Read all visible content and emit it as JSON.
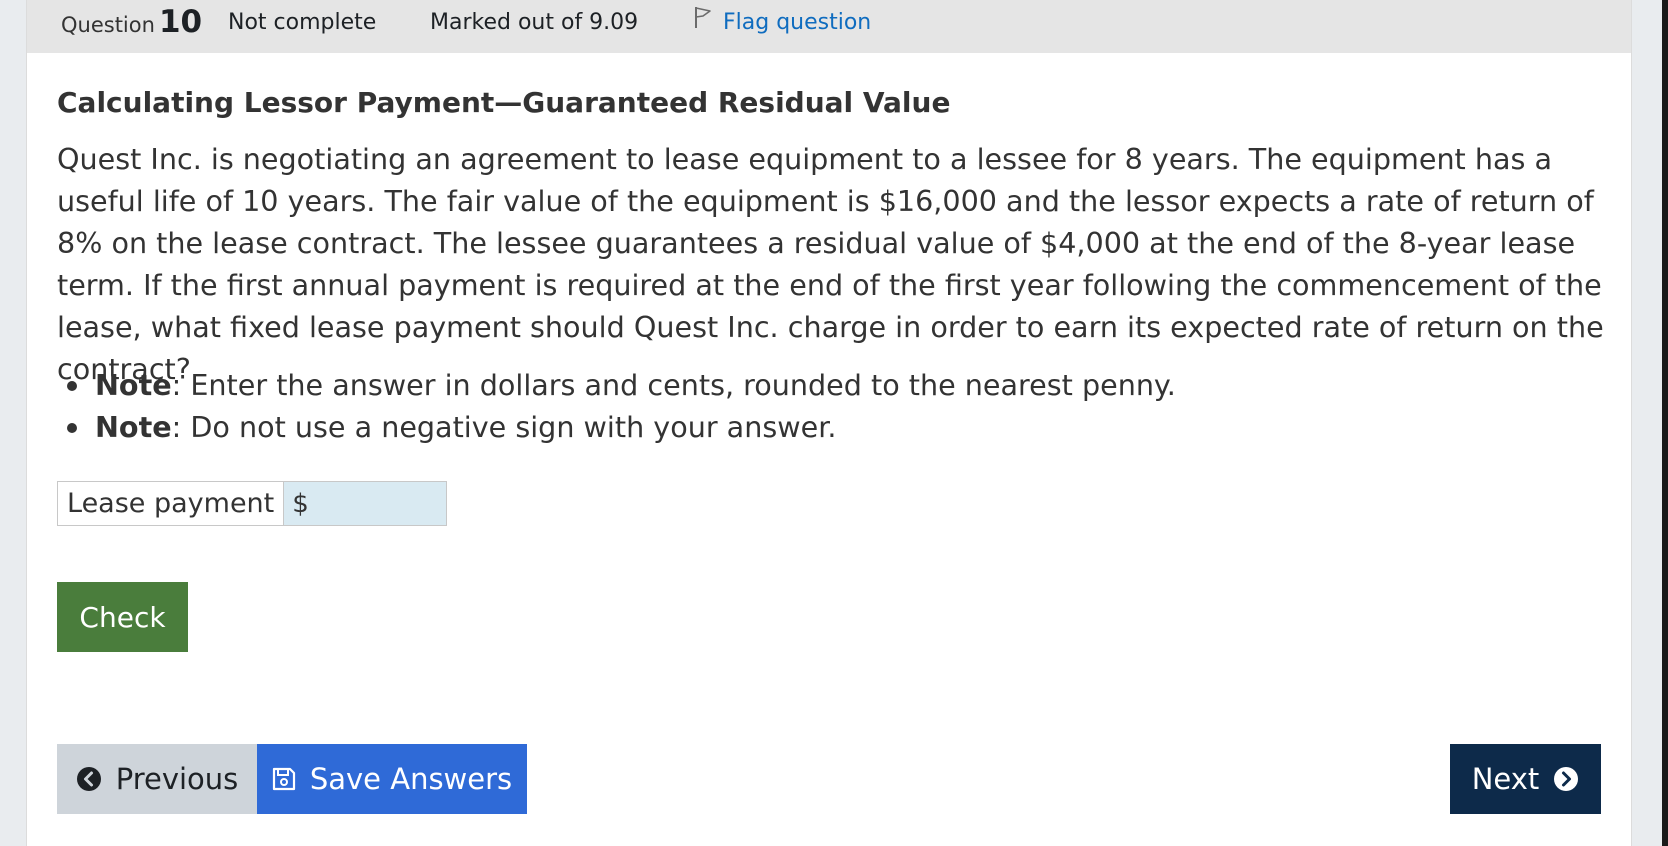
{
  "question_info": {
    "question_label": "Question",
    "question_number": "10",
    "state": "Not complete",
    "grade": "Marked out of 9.09",
    "flag_label": "Flag question",
    "flag_icon": "flag-icon"
  },
  "question": {
    "title": "Calculating Lessor Payment—Guaranteed Residual Value",
    "body": "Quest Inc. is negotiating an agreement to lease equipment to a lessee for 8 years. The equipment has a useful life of 10 years. The fair value of the equipment is $16,000 and the lessor expects a rate of return of 8% on the lease contract. The lessee guarantees a residual value of $4,000 at the end of the 8-year lease term. If the first annual payment is required at the end of the first year following the commencement of the lease, what fixed lease payment should Quest Inc. charge in order to earn its expected rate of return on the contract?",
    "notes": [
      {
        "bold": "Note",
        "text": ": Enter the answer in dollars and cents, rounded to the nearest penny."
      },
      {
        "bold": "Note",
        "text": ": Do not use a negative sign with your answer."
      }
    ]
  },
  "answer": {
    "label": "Lease payment",
    "currency": "$",
    "value": ""
  },
  "buttons": {
    "check": "Check",
    "previous": "Previous",
    "previous_icon": "chevron-left-circle-icon",
    "save": "Save Answers",
    "save_icon": "floppy-disk-icon",
    "next": "Next",
    "next_icon": "chevron-right-circle-icon"
  },
  "colors": {
    "check_button": "#4a7d3c",
    "save_button": "#2f6ad7",
    "next_button": "#0d2a4a",
    "previous_button": "#ced4da",
    "flag_link": "#0f6cbf",
    "answer_field": "#d9eaf2"
  }
}
